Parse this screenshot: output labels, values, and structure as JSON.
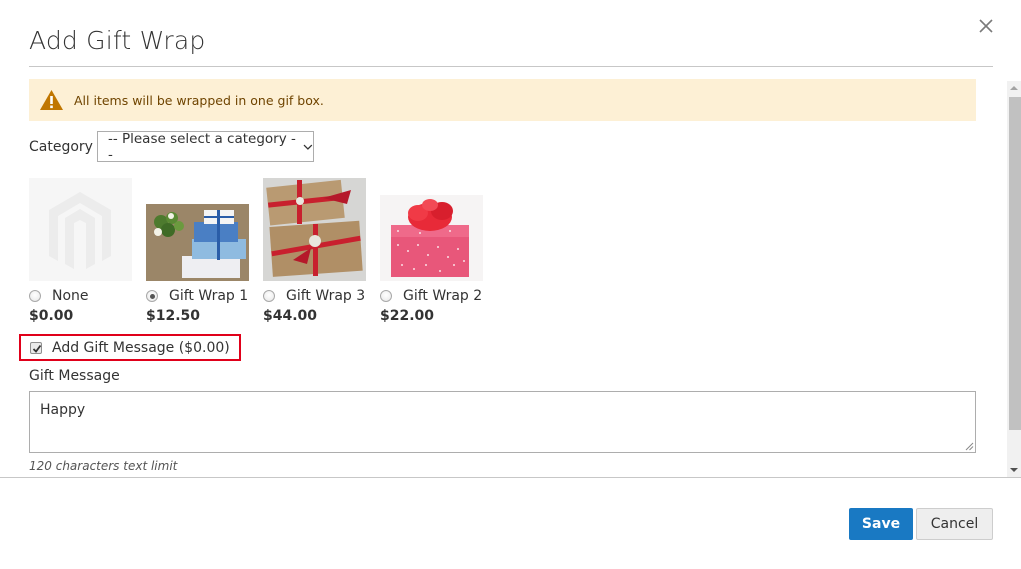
{
  "dialog": {
    "title": "Add Gift Wrap",
    "close_label": "close-icon"
  },
  "notice": {
    "icon": "warning-icon",
    "message": "All items will be wrapped in one gif box.",
    "color": "#fdf0d5"
  },
  "category": {
    "label": "Category",
    "selected": "-- Please select a category --"
  },
  "wraps": [
    {
      "name": "None",
      "price": "$0.00",
      "selected": false,
      "image": "placeholder-logo"
    },
    {
      "name": "Gift Wrap 1",
      "price": "$12.50",
      "selected": true,
      "image": "blue-gift-boxes"
    },
    {
      "name": "Gift Wrap 3",
      "price": "$44.00",
      "selected": false,
      "image": "kraft-paper-red-ribbon"
    },
    {
      "name": "Gift Wrap 2",
      "price": "$22.00",
      "selected": false,
      "image": "pink-polka-dot-box"
    }
  ],
  "gift_message": {
    "checkbox_label": "Add Gift Message ($0.00)",
    "checked": true,
    "field_label": "Gift Message",
    "value": "Happy",
    "limit_note": "120 characters text limit"
  },
  "footer": {
    "save_label": "Save",
    "cancel_label": "Cancel",
    "accent": "#1979c3"
  }
}
